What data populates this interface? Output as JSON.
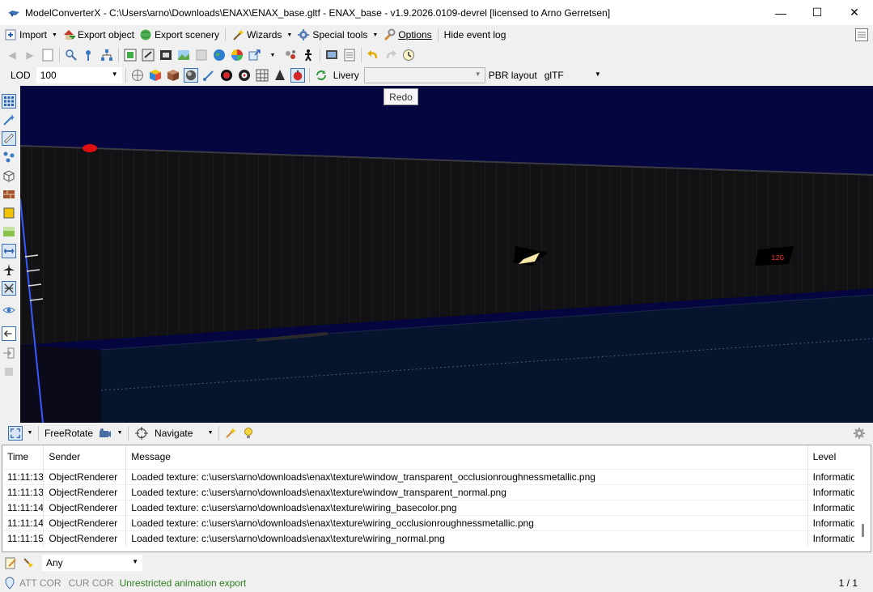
{
  "window": {
    "title": "ModelConverterX - C:\\Users\\arno\\Downloads\\ENAX\\ENAX_base.gltf - ENAX_base - v1.9.2026.0109-devrel [licensed to Arno Gerretsen]",
    "minimize": "—",
    "maximize": "☐",
    "close": "✕"
  },
  "menu": {
    "import": "Import",
    "export_object": "Export object",
    "export_scenery": "Export scenery",
    "wizards": "Wizards",
    "special_tools": "Special tools",
    "options": "Options",
    "hide_event_log": "Hide event log"
  },
  "toolbar2": {
    "lod_label": "LOD",
    "lod_value": "100",
    "livery_label": "Livery",
    "livery_value": "",
    "pbr_label": "PBR layout",
    "pbr_value": "glTF"
  },
  "tooltip": "Redo",
  "viewport": {
    "label_readout": "12G"
  },
  "view_toolbar": {
    "rotate_mode": "FreeRotate",
    "navigate": "Navigate"
  },
  "log": {
    "columns": [
      "Time",
      "Sender",
      "Message",
      "Level"
    ],
    "rows": [
      [
        "11:11:13",
        "ObjectRenderer",
        "Loaded texture: c:\\users\\arno\\downloads\\enax\\texture\\window_transparent_occlusionroughnessmetallic.png",
        "Information"
      ],
      [
        "11:11:13",
        "ObjectRenderer",
        "Loaded texture: c:\\users\\arno\\downloads\\enax\\texture\\window_transparent_normal.png",
        "Information"
      ],
      [
        "11:11:14",
        "ObjectRenderer",
        "Loaded texture: c:\\users\\arno\\downloads\\enax\\texture\\wiring_basecolor.png",
        "Information"
      ],
      [
        "11:11:14",
        "ObjectRenderer",
        "Loaded texture: c:\\users\\arno\\downloads\\enax\\texture\\wiring_occlusionroughnessmetallic.png",
        "Information"
      ],
      [
        "11:11:15",
        "ObjectRenderer",
        "Loaded texture: c:\\users\\arno\\downloads\\enax\\texture\\wiring_normal.png",
        "Information"
      ]
    ]
  },
  "filter": {
    "value": "Any"
  },
  "status": {
    "att_cor": "ATT COR",
    "cur_cor": "CUR COR",
    "message": "Unrestricted animation export",
    "page": "1 / 1"
  },
  "colors": {
    "viewport_bg": "#05053f",
    "status_green": "#2e7d1e"
  }
}
